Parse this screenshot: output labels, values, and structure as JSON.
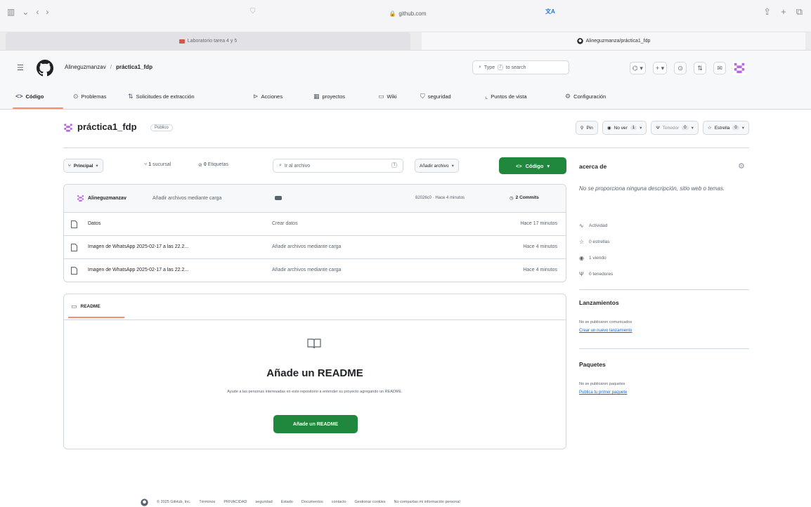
{
  "browser": {
    "url": "github.com",
    "tabs": [
      {
        "title": "Laboratorio tarea 4 y 5"
      },
      {
        "title": "Alineguzmanza/práctica1_fdp"
      }
    ]
  },
  "header": {
    "owner": "Alineguzmanzav",
    "separator": "/",
    "repo": "práctica1_fdp",
    "search_prefix": "Type",
    "search_key": "/",
    "search_suffix": "to search",
    "actions": {
      "copilot": "⌬ ▾",
      "new": "+ ▾",
      "issues": "⊙",
      "pulls": "⇅",
      "inbox": "✉"
    }
  },
  "nav": {
    "code": "Código",
    "issues": "Problemas",
    "pulls": "Solicitudes de extracción",
    "actions": "Acciones",
    "projects": "proyectos",
    "wiki": "Wiki",
    "security": "seguridad",
    "insights": "Puntos de vista",
    "settings": "Configuración"
  },
  "repo": {
    "name": "práctica1_fdp",
    "visibility": "Público",
    "pin": "Pin",
    "watch": "No ver",
    "watch_count": "1",
    "fork": "Tenedor",
    "fork_count": "0",
    "star": "Estrella",
    "star_count": "0"
  },
  "toolbar": {
    "branch": "Principal",
    "branches_count": "1",
    "branches_label": "sucursal",
    "tags_count": "0",
    "tags_label": "Etiquetas",
    "goto_placeholder": "Ir al archivo",
    "goto_key": "t",
    "add_file": "Añadir archivo",
    "code": "Código"
  },
  "commit": {
    "author": "Alineguzmanzav",
    "message": "Añadir archivos mediante carga",
    "meta": "82026c0 · Hace 4 minutos",
    "count": "2 Commits"
  },
  "files": [
    {
      "name": "Datos",
      "commit": "Crear datos",
      "age": "Hace 17 minutos"
    },
    {
      "name": "Imagen de WhatsApp 2025-02-17 a las 22.2...",
      "commit": "Añadir archivos mediante carga",
      "age": "Hace 4 minutos"
    },
    {
      "name": "Imagen de WhatsApp 2025-02-17 a las 22.2...",
      "commit": "Añadir archivos mediante carga",
      "age": "Hace 4 minutos"
    }
  ],
  "readme": {
    "tab": "README",
    "heading": "Añade un README",
    "description": "Ayude a las personas interesadas en este repositorio a entender su proyecto agregando un README.",
    "button": "Añade un README"
  },
  "about": {
    "title": "acerca de",
    "description": "No se proporciona ninguna descripción, sitio web o temas.",
    "stats": [
      {
        "icon": "activity-icon",
        "label": "Actividad"
      },
      {
        "icon": "star-icon",
        "label": "0 estrellas"
      },
      {
        "icon": "eye-icon",
        "label": "1 viendo"
      },
      {
        "icon": "fork-icon",
        "label": "0 tenedores"
      }
    ]
  },
  "releases": {
    "title": "Lanzamientos",
    "note": "No se publicaron comunicados",
    "link": "Crear un nuevo lanzamiento"
  },
  "packages": {
    "title": "Paquetes",
    "note": "No se publicaron paquetes",
    "link": "Publica tu primer paquete"
  },
  "footer": {
    "items": [
      "© 2025 GitHub, Inc.",
      "Términos",
      "PRIVACIDAD",
      "seguridad",
      "Estado",
      "Documentos",
      "contacto",
      "Gestionar cookies",
      "No compartas mi información personal"
    ]
  },
  "colors": {
    "accent_green": "#1f883d",
    "tab_underline": "#fd8c73",
    "link_blue": "#0969da"
  }
}
